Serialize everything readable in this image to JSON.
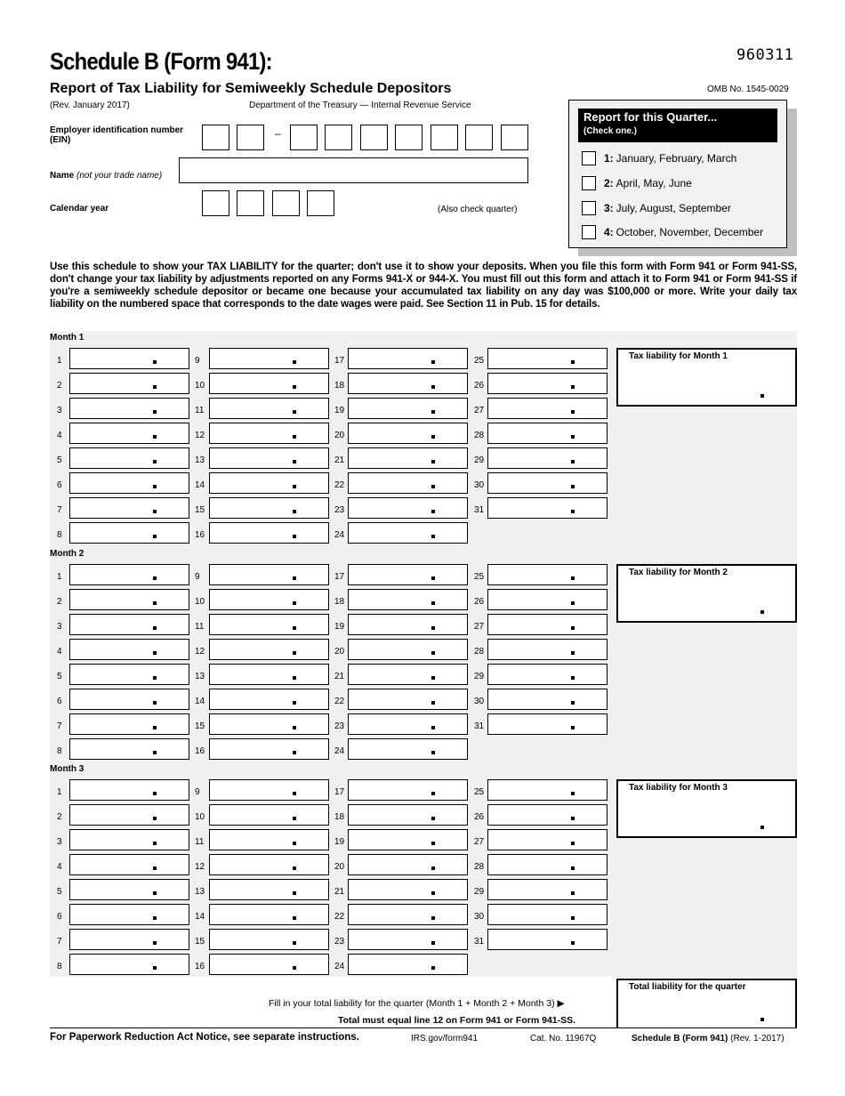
{
  "header": {
    "title": "Schedule B (Form 941):",
    "subtitle": "Report of Tax Liability for Semiweekly Schedule Depositors",
    "revision": "(Rev. January 2017)",
    "department": "Department of the Treasury — Internal Revenue Service",
    "form_code": "960311",
    "omb": "OMB No. 1545-0029"
  },
  "quarter": {
    "heading": "Report for this Quarter...",
    "subheading": "(Check one.)",
    "options": [
      {
        "num": "1:",
        "label": "January, February, March",
        "checked": false
      },
      {
        "num": "2:",
        "label": "April, May, June",
        "checked": false
      },
      {
        "num": "3:",
        "label": "July, August, September",
        "checked": false
      },
      {
        "num": "4:",
        "label": "October, November, December",
        "checked": false
      }
    ]
  },
  "ein": {
    "label_line1": "Employer identification number",
    "label_line2": "(EIN)",
    "separator": "–",
    "digits": [
      "",
      "",
      "",
      "",
      "",
      "",
      "",
      "",
      ""
    ]
  },
  "name": {
    "label": "Name",
    "label_note": "(not your trade name)",
    "value": ""
  },
  "calendar_year": {
    "label": "Calendar year",
    "digits": [
      "",
      "",
      "",
      ""
    ],
    "note": "(Also check quarter)"
  },
  "instructions": "Use this schedule to show your TAX LIABILITY for the quarter; don't use it to show your deposits. When you file this form with Form 941 or Form 941-SS, don't change your tax liability by adjustments reported on any Forms 941-X or 944-X. You must fill out this form and attach it to Form 941 or Form 941-SS if you're a semiweekly schedule depositor or became one because your accumulated tax liability on any day was $100,000 or more. Write your daily tax liability on the numbered space that corresponds to the date wages were paid. See Section 11 in Pub. 15 for details.",
  "months": [
    {
      "label": "Month 1",
      "total_label": "Tax liability for Month 1",
      "total_value": ""
    },
    {
      "label": "Month 2",
      "total_label": "Tax liability for Month 2",
      "total_value": ""
    },
    {
      "label": "Month 3",
      "total_label": "Tax liability for Month 3",
      "total_value": ""
    }
  ],
  "day_numbers": [
    "1",
    "2",
    "3",
    "4",
    "5",
    "6",
    "7",
    "8",
    "9",
    "10",
    "11",
    "12",
    "13",
    "14",
    "15",
    "16",
    "17",
    "18",
    "19",
    "20",
    "21",
    "22",
    "23",
    "24",
    "25",
    "26",
    "27",
    "28",
    "29",
    "30",
    "31"
  ],
  "quarter_total": {
    "label": "Total liability for the quarter",
    "fill_text": "Fill in your total liability for the quarter (Month 1 + Month 2 + Month 3) ▶",
    "must_text": "Total must equal line 12 on Form 941 or Form 941-SS.",
    "value": ""
  },
  "footer": {
    "paperwork": "For Paperwork Reduction Act Notice, see separate instructions.",
    "url": "IRS.gov/form941",
    "cat": "Cat. No. 11967Q",
    "form_name": "Schedule B (Form 941)",
    "form_rev": "(Rev. 1-2017)"
  }
}
